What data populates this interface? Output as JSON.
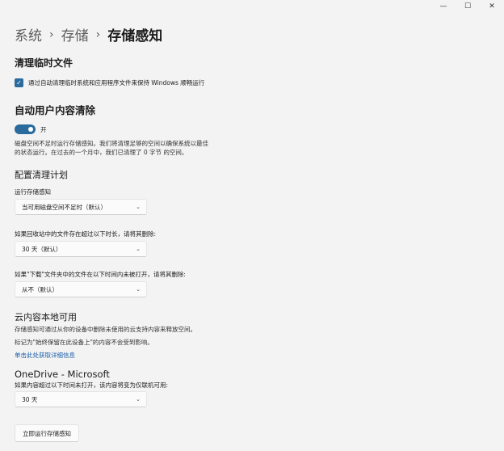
{
  "window": {
    "minimize_glyph": "—",
    "maximize_glyph": "☐",
    "close_glyph": "✕"
  },
  "breadcrumb": {
    "items": [
      "系统",
      "存储",
      "存储感知"
    ],
    "separator": "›"
  },
  "temp_files": {
    "heading": "清理临时文件",
    "checkbox_checked": true,
    "checkbox_label": "通过自动清理临时系统和应用程序文件来保持 Windows 顺畅运行"
  },
  "auto_cleanup": {
    "heading": "自动用户内容清除",
    "toggle_on": true,
    "toggle_state_label": "开",
    "description_line1": "磁盘空间不足时运行存储感知。我们将清理足够的空间以确保系统以最佳",
    "description_line2": "的状态运行。在过去的一个月中，我们已清理了 0 字节 的空间。"
  },
  "schedule": {
    "heading": "配置清理计划",
    "run_label": "运行存储感知",
    "run_value": "当可用磁盘空间不足时（默认）",
    "recycle_label": "如果回收站中的文件存在超过以下时长，请将其删除:",
    "recycle_value": "30 天（默认）",
    "downloads_label": "如果\"下载\"文件夹中的文件在以下时间内未被打开，请将其删除:",
    "downloads_value": "从不（默认）"
  },
  "cloud": {
    "heading": "云内容本地可用",
    "line1": "存储感知可通过从你的设备中删除未使用的云支持内容来释放空间。",
    "line2": "标记为\"始终保留在此设备上\"的内容不会受到影响。",
    "link": "单击此处获取详细信息"
  },
  "onedrive": {
    "heading": "OneDrive - Microsoft",
    "label": "如果内容超过以下时间未打开，该内容将变为仅联机可用:",
    "value": "30 天"
  },
  "run_now_button": "立即运行存储感知",
  "colors": {
    "accent": "#2a6a9c",
    "background": "#f3f3f3",
    "link": "#1d5fa8"
  },
  "icons": {
    "chevron": "chevron-down-icon",
    "check": "checkmark-icon"
  }
}
